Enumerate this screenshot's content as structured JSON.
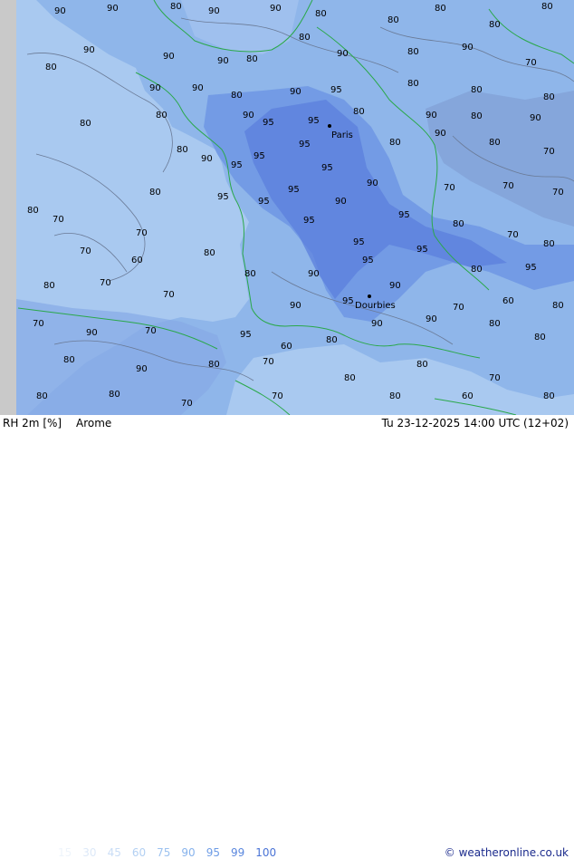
{
  "map": {
    "cities": [
      {
        "name": "Paris"
      },
      {
        "name": "Dourbies"
      }
    ],
    "contour_labels": [
      "90",
      "95",
      "80",
      "70",
      "60",
      "90",
      "95",
      "80",
      "90",
      "70"
    ]
  },
  "footer": {
    "variable": "RH 2m [%]",
    "model": "Arome",
    "datetime": "Tu 23-12-2025 14:00 UTC (12+02)",
    "credit": "© weatheronline.co.uk",
    "legend": [
      {
        "value": "15",
        "color": "#eef4fb"
      },
      {
        "value": "30",
        "color": "#dde9f8"
      },
      {
        "value": "45",
        "color": "#c9ddf6"
      },
      {
        "value": "60",
        "color": "#b3d0f3"
      },
      {
        "value": "75",
        "color": "#9cc2f0"
      },
      {
        "value": "90",
        "color": "#86b2ec"
      },
      {
        "value": "95",
        "color": "#6d9ce6"
      },
      {
        "value": "99",
        "color": "#5a87de"
      },
      {
        "value": "100",
        "color": "#4a73d6"
      }
    ]
  },
  "colors": {
    "coast": "#2aa84a",
    "contour": "#6a7a96",
    "land_base": "#8fb6ea",
    "sea": "#a9c9f0",
    "moist": "#6f97e4",
    "very_moist": "#5b7fdc",
    "edge": "#c9c9c9"
  }
}
